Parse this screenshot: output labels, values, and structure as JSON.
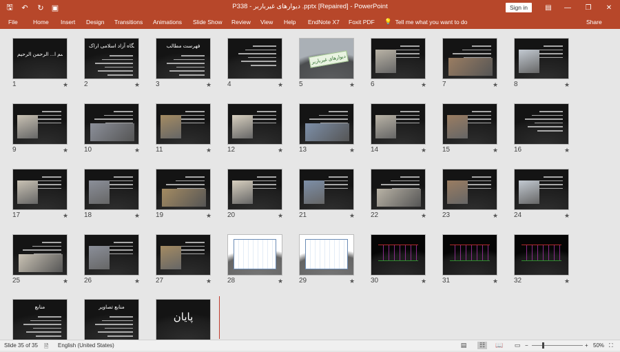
{
  "titlebar": {
    "title": "P338 - دیوارهای غیرباربر .pptx [Repaired]  -  PowerPoint",
    "signin_label": "Sign in",
    "icons": [
      "save-icon",
      "undo-icon",
      "redo-icon",
      "present-icon"
    ]
  },
  "ribbon": {
    "tabs": [
      "File",
      "Home",
      "Insert",
      "Design",
      "Transitions",
      "Animations",
      "Slide Show",
      "Review",
      "View",
      "Help",
      "EndNote X7",
      "Foxit PDF"
    ],
    "tell_me": "Tell me what you want to do",
    "share_label": "Share"
  },
  "slides": [
    {
      "num": "1",
      "title": "بسم ا... الرحمن الرحیم",
      "kind": "title"
    },
    {
      "num": "2",
      "title": "دانشگاه آزاد اسلامی اراک",
      "kind": "lines"
    },
    {
      "num": "3",
      "title": "فهرست مطالب",
      "kind": "lines"
    },
    {
      "num": "4",
      "title": "",
      "kind": "lines"
    },
    {
      "num": "5",
      "title": "دیوارهای غیرباربر",
      "kind": "banner"
    },
    {
      "num": "6",
      "title": "",
      "kind": "pic"
    },
    {
      "num": "7",
      "title": "",
      "kind": "pic"
    },
    {
      "num": "8",
      "title": "",
      "kind": "pic"
    },
    {
      "num": "9",
      "title": "",
      "kind": "pic"
    },
    {
      "num": "10",
      "title": "",
      "kind": "pic"
    },
    {
      "num": "11",
      "title": "",
      "kind": "pic"
    },
    {
      "num": "12",
      "title": "",
      "kind": "pic"
    },
    {
      "num": "13",
      "title": "",
      "kind": "pic"
    },
    {
      "num": "14",
      "title": "",
      "kind": "pic"
    },
    {
      "num": "15",
      "title": "",
      "kind": "pic"
    },
    {
      "num": "16",
      "title": "",
      "kind": "lines"
    },
    {
      "num": "17",
      "title": "",
      "kind": "pic"
    },
    {
      "num": "18",
      "title": "",
      "kind": "pic"
    },
    {
      "num": "19",
      "title": "",
      "kind": "pic"
    },
    {
      "num": "20",
      "title": "",
      "kind": "pic"
    },
    {
      "num": "21",
      "title": "",
      "kind": "pic"
    },
    {
      "num": "22",
      "title": "",
      "kind": "pic"
    },
    {
      "num": "23",
      "title": "",
      "kind": "pic"
    },
    {
      "num": "24",
      "title": "",
      "kind": "pic"
    },
    {
      "num": "25",
      "title": "",
      "kind": "pic"
    },
    {
      "num": "26",
      "title": "",
      "kind": "pic"
    },
    {
      "num": "27",
      "title": "",
      "kind": "pic"
    },
    {
      "num": "28",
      "title": "",
      "kind": "drawing"
    },
    {
      "num": "29",
      "title": "",
      "kind": "drawing"
    },
    {
      "num": "30",
      "title": "",
      "kind": "cad"
    },
    {
      "num": "31",
      "title": "",
      "kind": "cad"
    },
    {
      "num": "32",
      "title": "",
      "kind": "cad"
    },
    {
      "num": "",
      "title": "منابع",
      "kind": "lines"
    },
    {
      "num": "",
      "title": "منابع تصاویر",
      "kind": "lines"
    },
    {
      "num": "",
      "title": "پایان",
      "kind": "end"
    }
  ],
  "status": {
    "slide_info": "Slide 35 of 35",
    "language": "English (United States)",
    "zoom": "50%"
  }
}
